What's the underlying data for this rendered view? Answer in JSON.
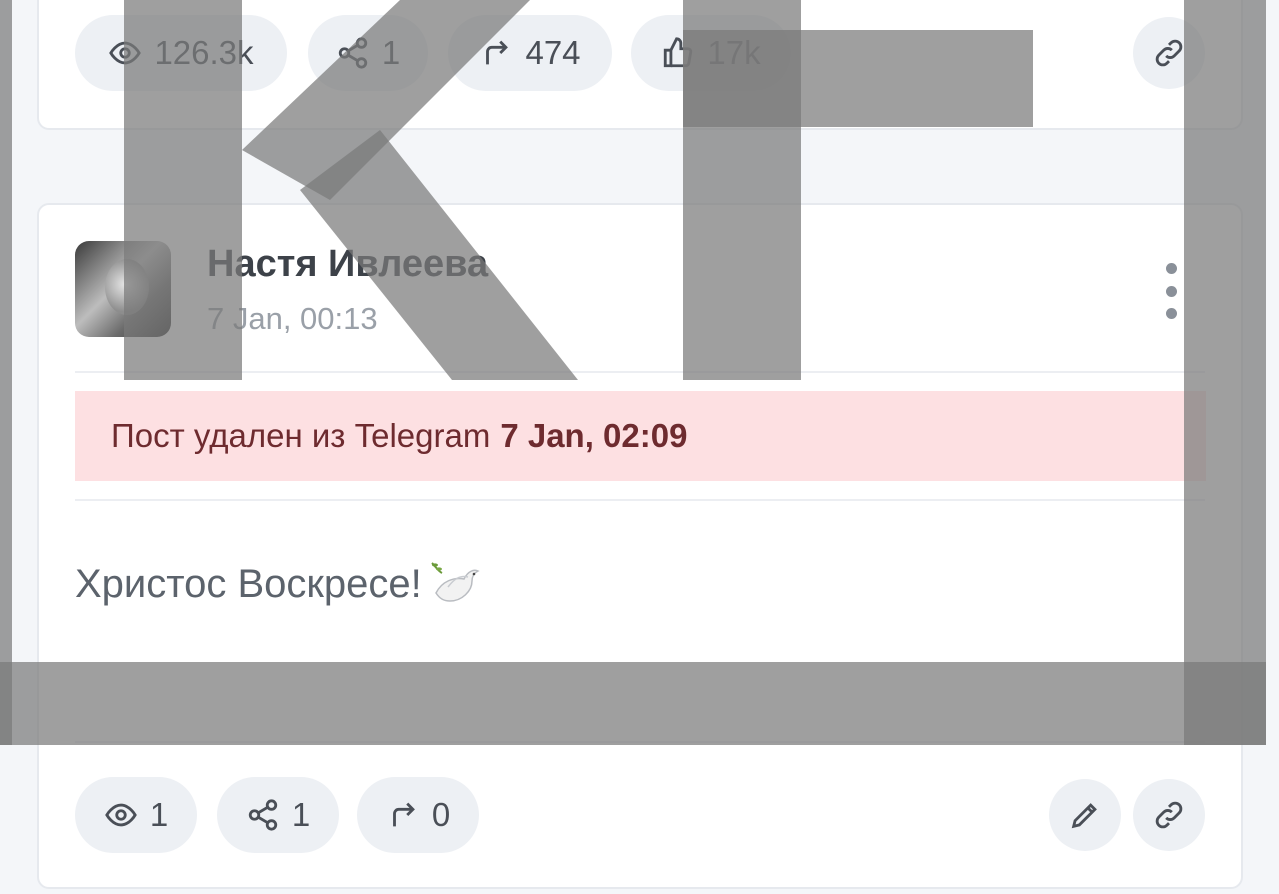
{
  "top_card": {
    "stats": {
      "views": "126.3k",
      "shares": "1",
      "forwards": "474",
      "likes": "17k"
    }
  },
  "post": {
    "author": "Настя Ивлеева",
    "date": "7 Jan, 00:13",
    "deleted_notice": {
      "text": "Пост удален из Telegram",
      "time": "7 Jan, 02:09"
    },
    "text": "Христос Воскресе!",
    "emoji": "dove",
    "stats": {
      "views": "1",
      "shares": "1",
      "forwards": "0"
    }
  },
  "watermark_text": "КГ"
}
